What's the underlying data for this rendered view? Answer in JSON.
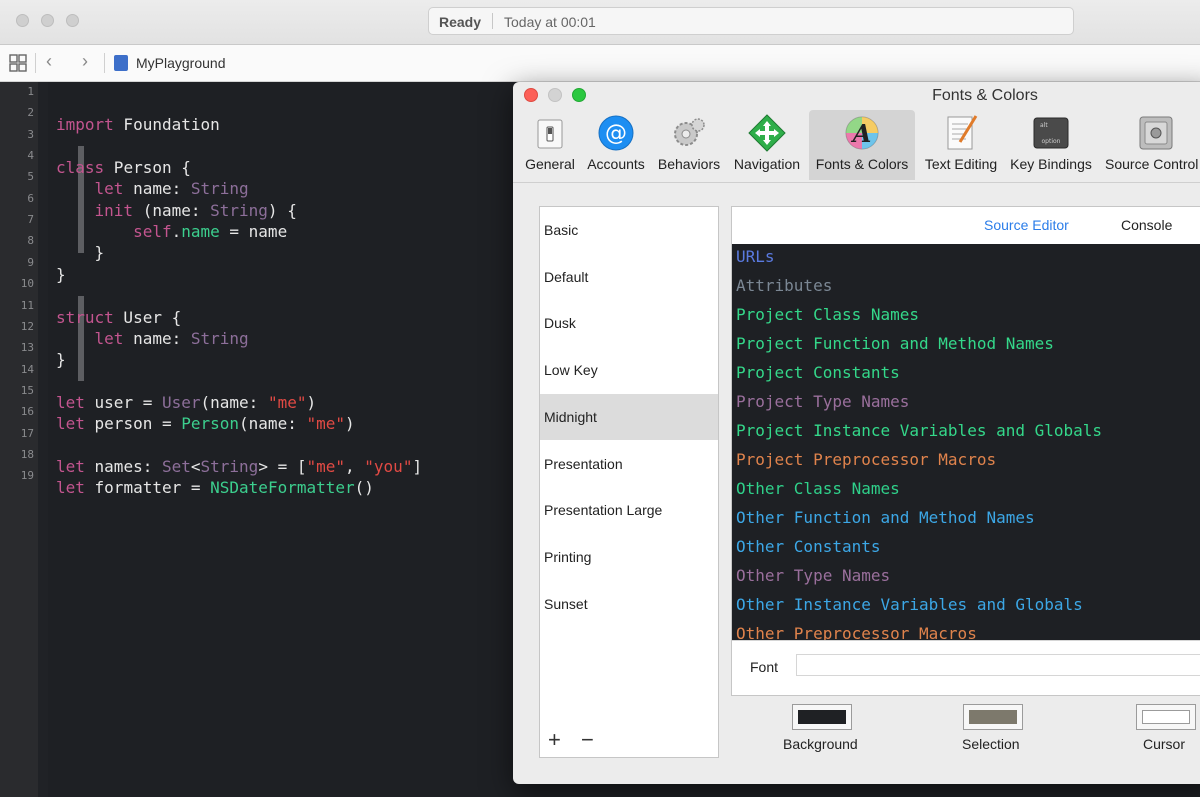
{
  "window": {
    "status": {
      "state": "Ready",
      "time": "Today at 00:01"
    },
    "breadcrumb": "MyPlayground"
  },
  "editor": {
    "line_numbers": [
      "1",
      "2",
      "3",
      "4",
      "5",
      "6",
      "7",
      "8",
      "9",
      "10",
      "11",
      "12",
      "13",
      "14",
      "15",
      "16",
      "17",
      "18",
      "19"
    ],
    "lines": [
      [],
      [
        [
          "kw",
          "import"
        ],
        [
          "pl",
          " Foundation"
        ]
      ],
      [],
      [
        [
          "kw",
          "class"
        ],
        [
          "pl",
          " Person {"
        ]
      ],
      [
        [
          "pl",
          "    "
        ],
        [
          "kw",
          "let"
        ],
        [
          "pl",
          " name: "
        ],
        [
          "ty",
          "String"
        ]
      ],
      [
        [
          "pl",
          "    "
        ],
        [
          "kw",
          "init"
        ],
        [
          "pl",
          " (name: "
        ],
        [
          "ty",
          "String"
        ],
        [
          "pl",
          ") {"
        ]
      ],
      [
        [
          "pl",
          "        "
        ],
        [
          "kw",
          "self"
        ],
        [
          "pl",
          "."
        ],
        [
          "fn",
          "name"
        ],
        [
          "pl",
          " = name"
        ]
      ],
      [
        [
          "pl",
          "    }"
        ]
      ],
      [
        [
          "pl",
          "}"
        ]
      ],
      [],
      [
        [
          "kw",
          "struct"
        ],
        [
          "pl",
          " User {"
        ]
      ],
      [
        [
          "pl",
          "    "
        ],
        [
          "kw",
          "let"
        ],
        [
          "pl",
          " name: "
        ],
        [
          "ty",
          "String"
        ]
      ],
      [
        [
          "pl",
          "}"
        ]
      ],
      [],
      [
        [
          "kw",
          "let"
        ],
        [
          "pl",
          " user = "
        ],
        [
          "ty",
          "User"
        ],
        [
          "pl",
          "(name: "
        ],
        [
          "st",
          "\"me\""
        ],
        [
          "pl",
          ")"
        ]
      ],
      [
        [
          "kw",
          "let"
        ],
        [
          "pl",
          " person = "
        ],
        [
          "fn",
          "Person"
        ],
        [
          "pl",
          "(name: "
        ],
        [
          "st",
          "\"me\""
        ],
        [
          "pl",
          ")"
        ]
      ],
      [],
      [
        [
          "kw",
          "let"
        ],
        [
          "pl",
          " names: "
        ],
        [
          "ty",
          "Set"
        ],
        [
          "pl",
          "<"
        ],
        [
          "ty",
          "String"
        ],
        [
          "pl",
          "> = ["
        ],
        [
          "st",
          "\"me\""
        ],
        [
          "pl",
          ", "
        ],
        [
          "st",
          "\"you\""
        ],
        [
          "pl",
          "]"
        ]
      ],
      [
        [
          "kw",
          "let"
        ],
        [
          "pl",
          " formatter = "
        ],
        [
          "fn",
          "NSDateFormatter"
        ],
        [
          "pl",
          "()"
        ]
      ]
    ]
  },
  "prefs": {
    "title": "Fonts & Colors",
    "tabs": [
      {
        "label": "General",
        "icon": "general-switch-icon"
      },
      {
        "label": "Accounts",
        "icon": "at-sign-icon"
      },
      {
        "label": "Behaviors",
        "icon": "gears-icon"
      },
      {
        "label": "Navigation",
        "icon": "navigation-arrows-icon"
      },
      {
        "label": "Fonts & Colors",
        "icon": "fonts-colors-icon",
        "selected": true
      },
      {
        "label": "Text Editing",
        "icon": "text-editing-icon"
      },
      {
        "label": "Key Bindings",
        "icon": "option-key-icon"
      },
      {
        "label": "Source Control",
        "icon": "vault-icon"
      }
    ],
    "key_icon_text": {
      "top": "alt",
      "bottom": "option"
    },
    "themes": [
      "Basic",
      "Default",
      "Dusk",
      "Low Key",
      "Midnight",
      "Presentation",
      "Presentation Large",
      "Printing",
      "Sunset"
    ],
    "selected_theme": "Midnight",
    "theme_actions": {
      "add": "+",
      "remove": "−"
    },
    "editor_tabs": {
      "source": "Source Editor",
      "console": "Console"
    },
    "syntax_items": [
      {
        "label": "URLs",
        "color": "#5a7ae0"
      },
      {
        "label": "Attributes",
        "color": "#7b8794"
      },
      {
        "label": "Project Class Names",
        "color": "#34d88a"
      },
      {
        "label": "Project Function and Method Names",
        "color": "#34d88a"
      },
      {
        "label": "Project Constants",
        "color": "#34d88a"
      },
      {
        "label": "Project Type Names",
        "color": "#9a6f9c"
      },
      {
        "label": "Project Instance Variables and Globals",
        "color": "#34d88a"
      },
      {
        "label": "Project Preprocessor Macros",
        "color": "#e0834c"
      },
      {
        "label": "Other Class Names",
        "color": "#2fd08a"
      },
      {
        "label": "Other Function and Method Names",
        "color": "#3ca7e6"
      },
      {
        "label": "Other Constants",
        "color": "#3ca7e6"
      },
      {
        "label": "Other Type Names",
        "color": "#9a6f9c"
      },
      {
        "label": "Other Instance Variables and Globals",
        "color": "#3ca7e6"
      },
      {
        "label": "Other Preprocessor Macros",
        "color": "#e0834c"
      }
    ],
    "font_label": "Font",
    "swatches": [
      {
        "label": "Background",
        "color": "#1f2124"
      },
      {
        "label": "Selection",
        "color": "#7d796c"
      },
      {
        "label": "Cursor",
        "color": "#ffffff"
      }
    ]
  }
}
